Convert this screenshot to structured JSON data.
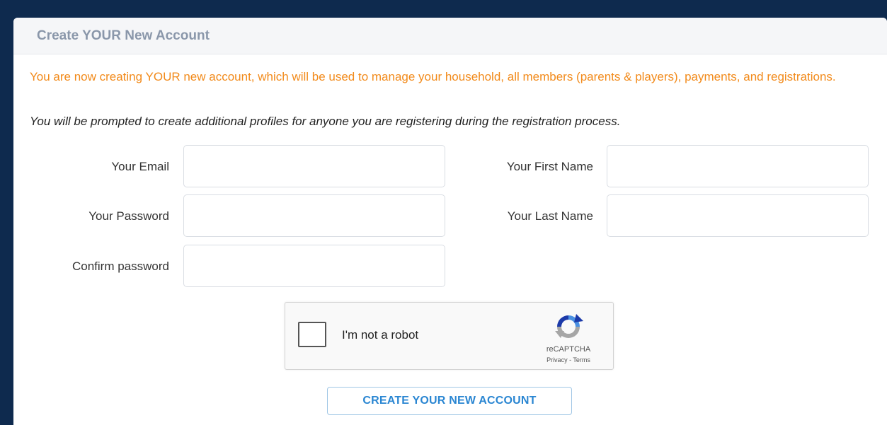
{
  "panel": {
    "title": "Create YOUR New Account"
  },
  "notice": "You are now creating YOUR new account, which will be used to manage your household, all members (parents & players), payments, and registrations.",
  "note": "You will be prompted to create additional profiles for anyone you are registering during the registration process.",
  "form": {
    "email": {
      "label": "Your Email",
      "value": ""
    },
    "password": {
      "label": "Your Password",
      "value": ""
    },
    "confirm_password": {
      "label": "Confirm password",
      "value": ""
    },
    "first_name": {
      "label": "Your First Name",
      "value": ""
    },
    "last_name": {
      "label": "Your Last Name",
      "value": ""
    }
  },
  "captcha": {
    "label": "I'm not a robot",
    "brand": "reCAPTCHA",
    "privacy": "Privacy",
    "separator": " - ",
    "terms": "Terms",
    "icon": "recaptcha-logo-icon"
  },
  "submit_label": "CREATE YOUR NEW ACCOUNT",
  "colors": {
    "background": "#0e2a4e",
    "notice": "#f28a1a",
    "button_text": "#2a86d2"
  }
}
